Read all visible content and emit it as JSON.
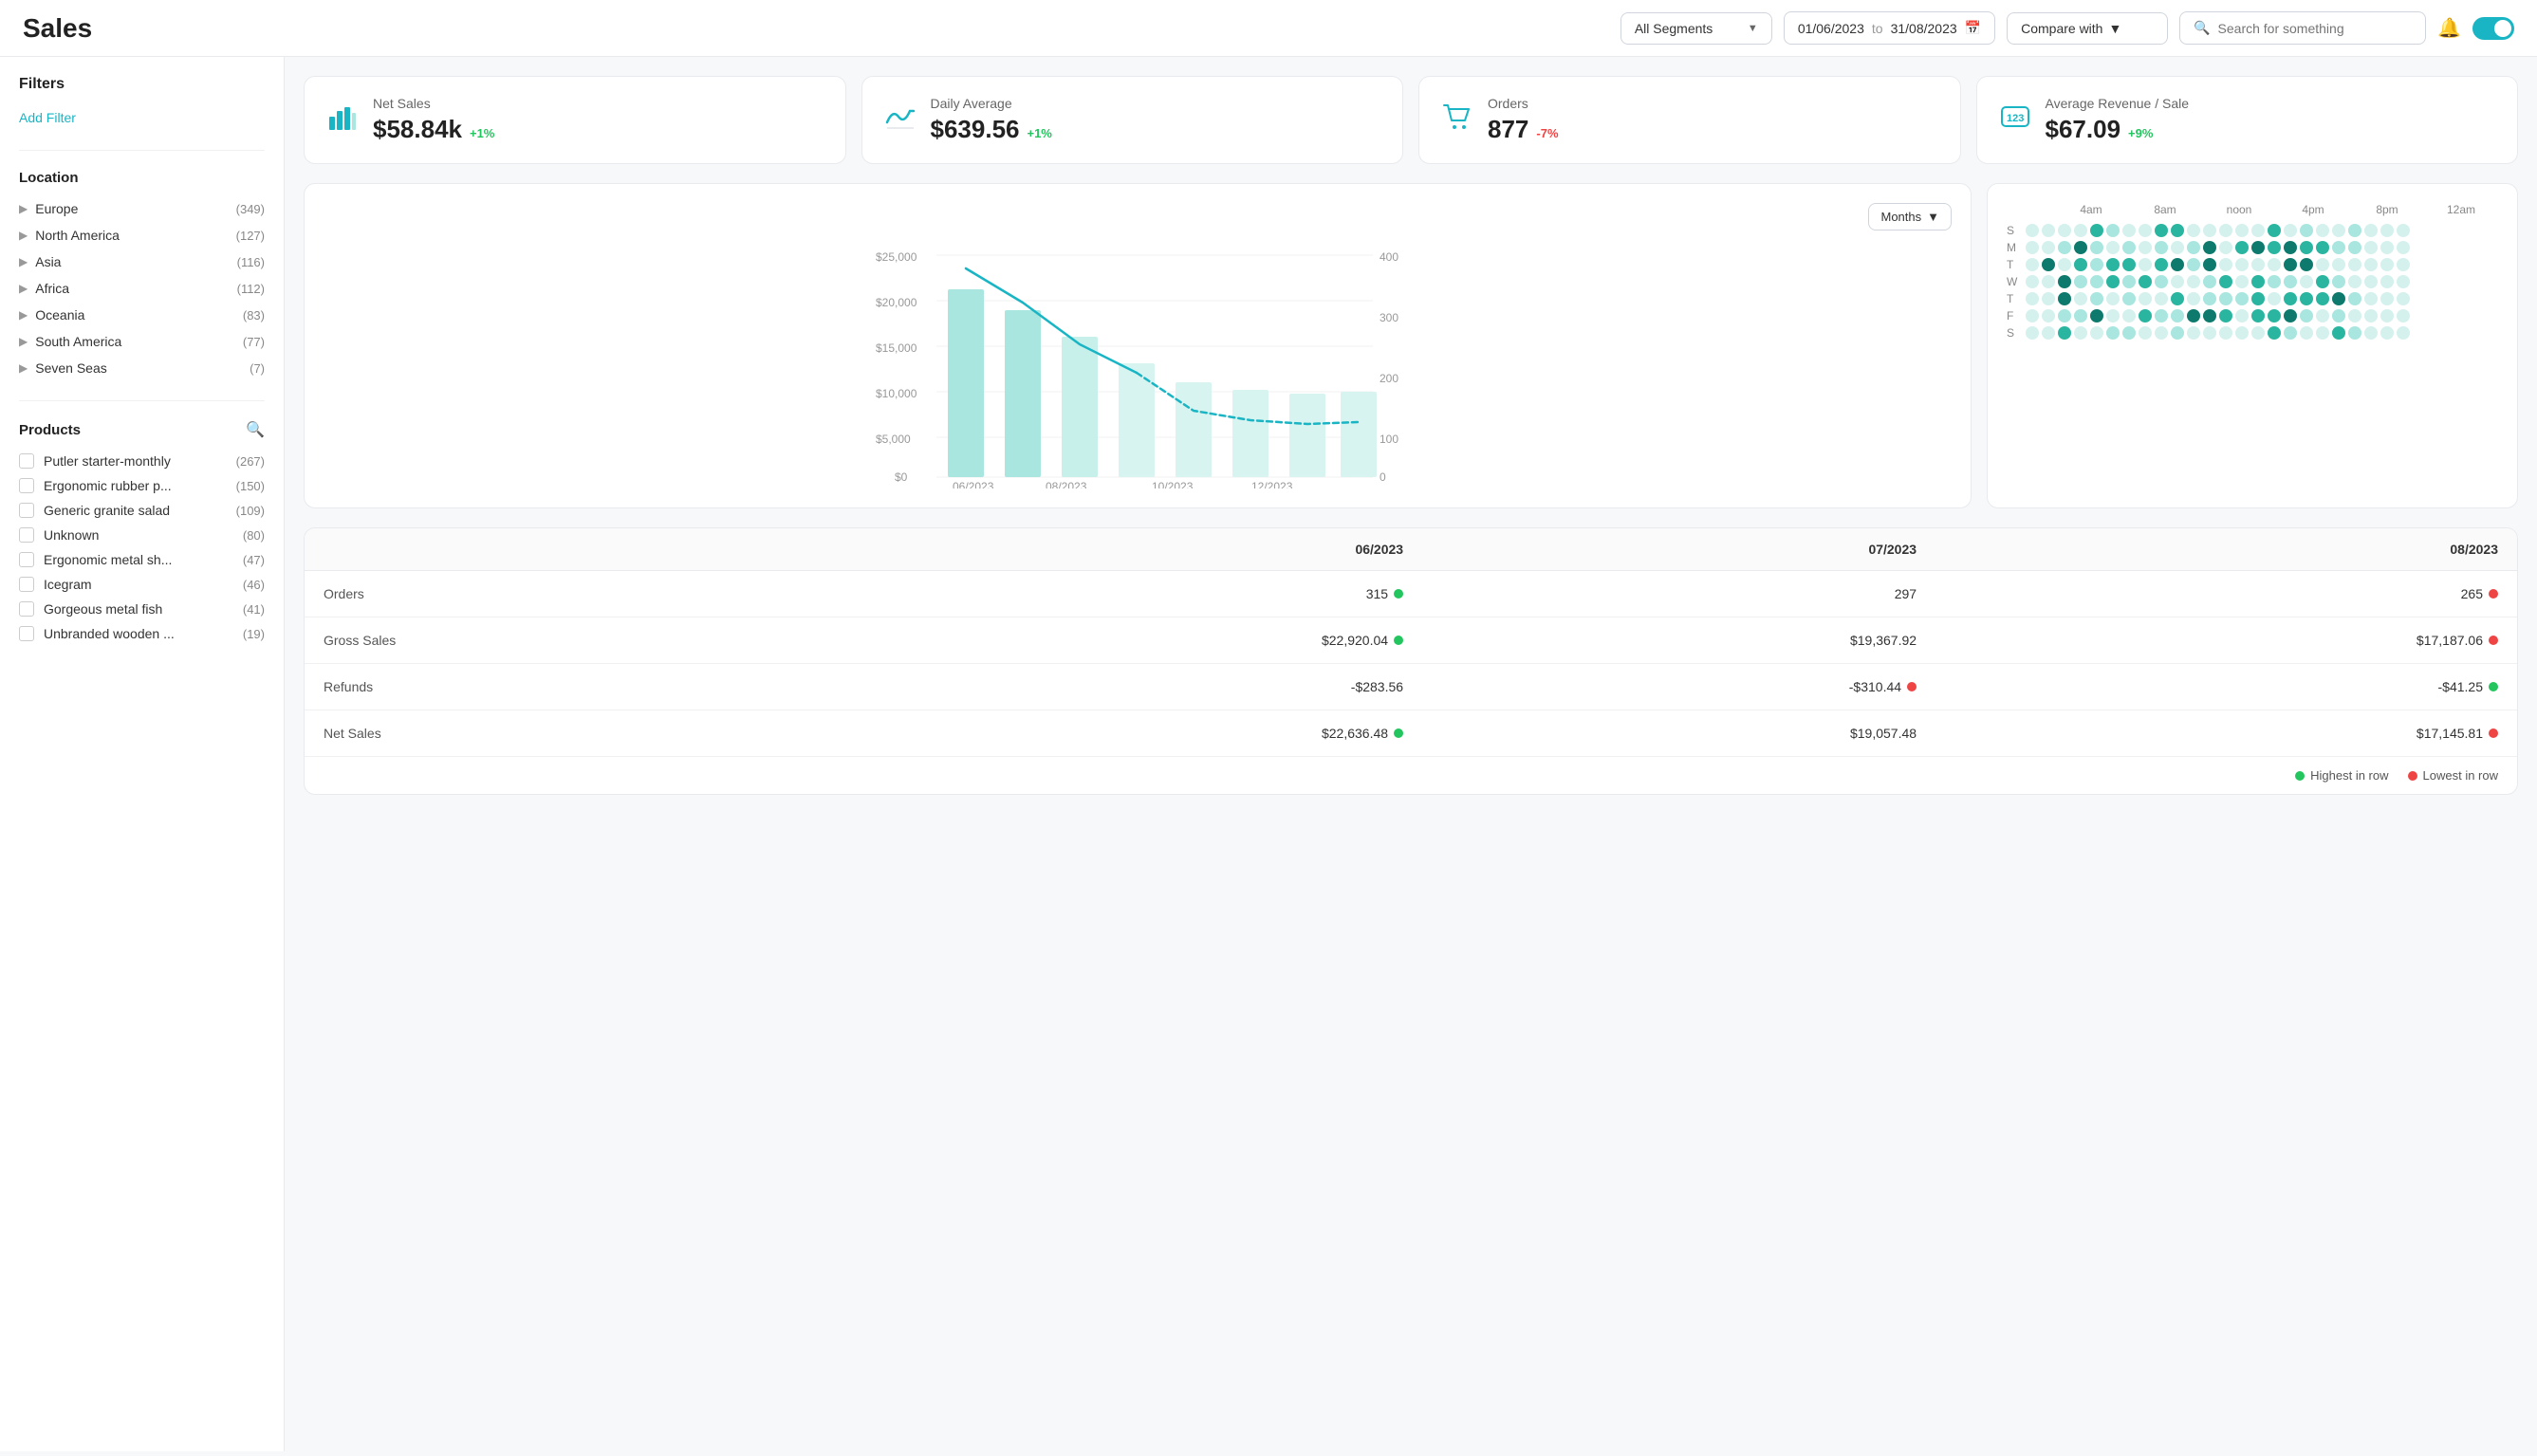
{
  "header": {
    "title": "Sales",
    "segment_placeholder": "All Segments",
    "date_from": "01/06/2023",
    "date_to": "31/08/2023",
    "date_separator": "to",
    "compare_label": "Compare with",
    "search_placeholder": "Search for something"
  },
  "filters": {
    "title": "Filters",
    "add_filter_label": "Add Filter"
  },
  "location": {
    "title": "Location",
    "items": [
      {
        "name": "Europe",
        "count": "(349)"
      },
      {
        "name": "North America",
        "count": "(127)"
      },
      {
        "name": "Asia",
        "count": "(116)"
      },
      {
        "name": "Africa",
        "count": "(112)"
      },
      {
        "name": "Oceania",
        "count": "(83)"
      },
      {
        "name": "South America",
        "count": "(77)"
      },
      {
        "name": "Seven Seas",
        "count": "(7)"
      }
    ]
  },
  "products": {
    "title": "Products",
    "items": [
      {
        "name": "Putler starter-monthly",
        "count": "(267)"
      },
      {
        "name": "Ergonomic rubber p...",
        "count": "(150)"
      },
      {
        "name": "Generic granite salad",
        "count": "(109)"
      },
      {
        "name": "Unknown",
        "count": "(80)"
      },
      {
        "name": "Ergonomic metal sh...",
        "count": "(47)"
      },
      {
        "name": "Icegram",
        "count": "(46)"
      },
      {
        "name": "Gorgeous metal fish",
        "count": "(41)"
      },
      {
        "name": "Unbranded wooden ...",
        "count": "(19)"
      }
    ]
  },
  "metrics": [
    {
      "id": "net-sales",
      "label": "Net Sales",
      "value": "$58.84k",
      "change": "+1%",
      "change_type": "positive",
      "icon": "bar-chart"
    },
    {
      "id": "daily-average",
      "label": "Daily Average",
      "value": "$639.56",
      "change": "+1%",
      "change_type": "positive",
      "icon": "wave-chart"
    },
    {
      "id": "orders",
      "label": "Orders",
      "value": "877",
      "change": "-7%",
      "change_type": "negative",
      "icon": "cart"
    },
    {
      "id": "avg-revenue",
      "label": "Average Revenue / Sale",
      "value": "$67.09",
      "change": "+9%",
      "change_type": "positive",
      "icon": "tag-123"
    }
  ],
  "chart": {
    "period_selector": "Months",
    "y_labels": [
      "$25,000",
      "$20,000",
      "$15,000",
      "$10,000",
      "$5,000",
      "$0"
    ],
    "y_right_labels": [
      "400",
      "300",
      "200",
      "100",
      "0"
    ],
    "x_labels": [
      "06/2023",
      "08/2023",
      "10/2023",
      "12/2023"
    ]
  },
  "dot_chart": {
    "time_labels": [
      "4am",
      "8am",
      "noon",
      "4pm",
      "8pm",
      "12am"
    ],
    "day_labels": [
      "S",
      "M",
      "T",
      "W",
      "T",
      "F",
      "S"
    ]
  },
  "data_table": {
    "columns": [
      "",
      "06/2023",
      "07/2023",
      "08/2023"
    ],
    "rows": [
      {
        "label": "Orders",
        "values": [
          {
            "text": "315",
            "dot": "green"
          },
          {
            "text": "297",
            "dot": null
          },
          {
            "text": "265",
            "dot": "red"
          }
        ]
      },
      {
        "label": "Gross Sales",
        "values": [
          {
            "text": "$22,920.04",
            "dot": "green"
          },
          {
            "text": "$19,367.92",
            "dot": null
          },
          {
            "text": "$17,187.06",
            "dot": "red"
          }
        ]
      },
      {
        "label": "Refunds",
        "values": [
          {
            "text": "-$283.56",
            "dot": null
          },
          {
            "text": "-$310.44",
            "dot": "red"
          },
          {
            "text": "-$41.25",
            "dot": "green"
          }
        ]
      },
      {
        "label": "Net Sales",
        "values": [
          {
            "text": "$22,636.48",
            "dot": "green"
          },
          {
            "text": "$19,057.48",
            "dot": null
          },
          {
            "text": "$17,145.81",
            "dot": "red"
          }
        ]
      }
    ],
    "legend": {
      "highest": "Highest in row",
      "lowest": "Lowest in row"
    }
  }
}
